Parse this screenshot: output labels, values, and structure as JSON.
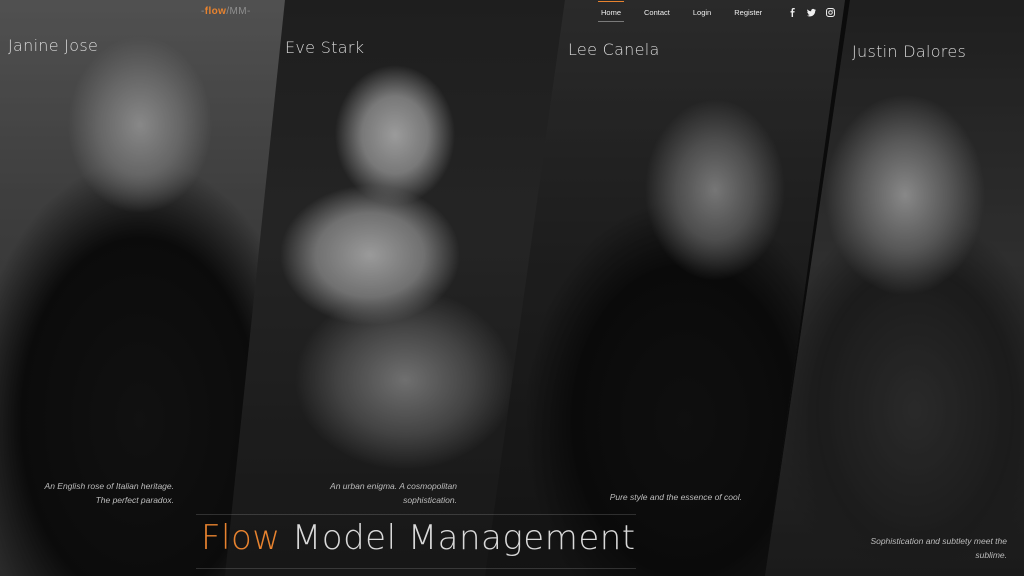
{
  "header": {
    "logo_prefix": "-",
    "logo_brand": "flow",
    "logo_sep": "/",
    "logo_suffix": "MM-",
    "nav": [
      {
        "label": "Home"
      },
      {
        "label": "Contact"
      },
      {
        "label": "Login"
      },
      {
        "label": "Register"
      }
    ],
    "socials": [
      "facebook-icon",
      "twitter-icon",
      "instagram-icon"
    ]
  },
  "models": [
    {
      "name": "Janine Jose",
      "tagline_1": "An English rose of Italian heritage.",
      "tagline_2": "The perfect paradox."
    },
    {
      "name": "Eve Stark",
      "tagline_1": "An urban enigma. A cosmopolitan",
      "tagline_2": "sophistication."
    },
    {
      "name": "Lee Canela",
      "tagline_1": "Pure style and the essence of cool.",
      "tagline_2": ""
    },
    {
      "name": "Justin Dalores",
      "tagline_1": "Sophistication and subtlety meet the",
      "tagline_2": "sublime."
    }
  ],
  "hero": {
    "brand": "Flow",
    "rest": " Model Management"
  },
  "colors": {
    "accent": "#e8832f",
    "background": "#0b0b0b",
    "text": "#d9d9d9"
  }
}
